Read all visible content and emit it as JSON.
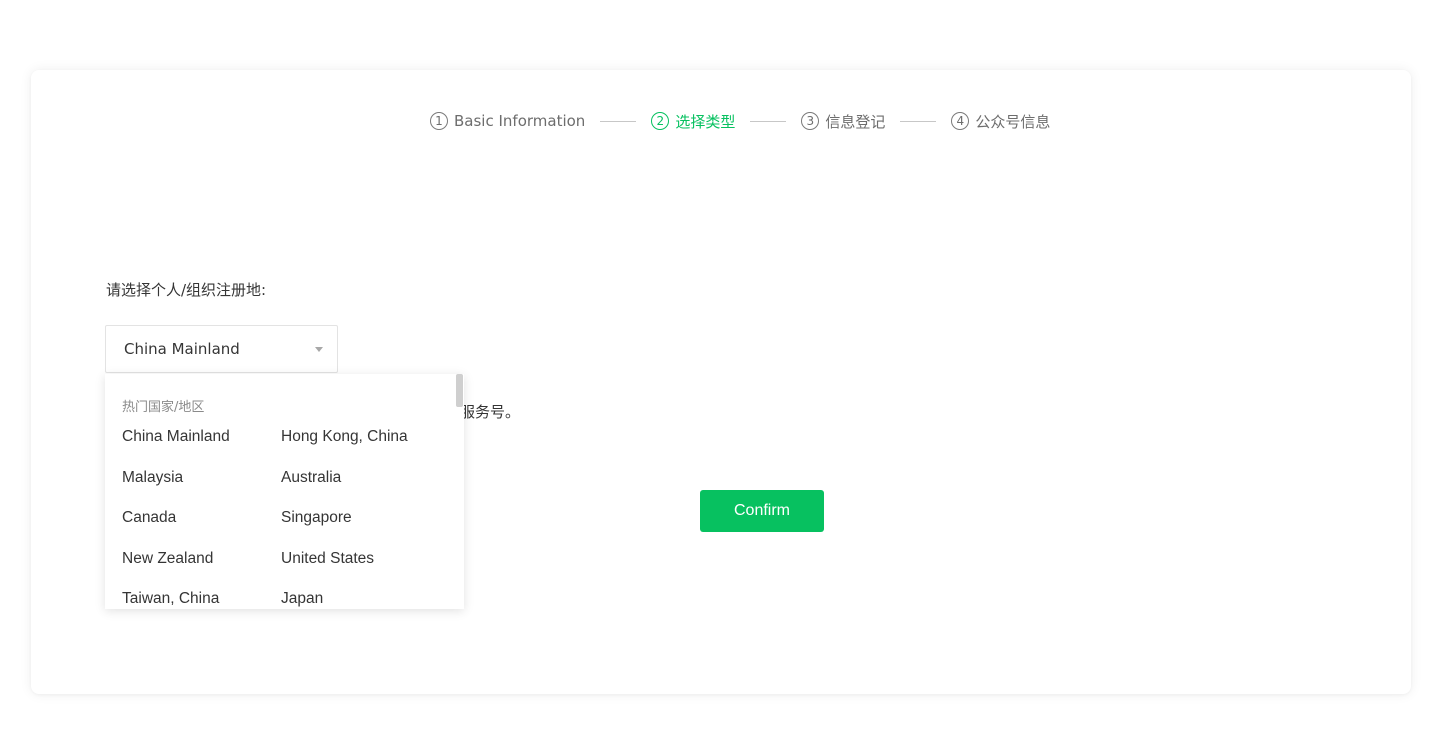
{
  "steps": [
    {
      "num": "1",
      "label": "Basic Information",
      "active": false
    },
    {
      "num": "2",
      "label": "选择类型",
      "active": true
    },
    {
      "num": "3",
      "label": "信息登记",
      "active": false
    },
    {
      "num": "4",
      "label": "公众号信息",
      "active": false
    }
  ],
  "region": {
    "label": "请选择个人/组织注册地:",
    "selected": "China Mainland"
  },
  "partially_hidden_text": "服务号。",
  "confirm_label": "Confirm",
  "dropdown": {
    "group_title": "热门国家/地区",
    "options": [
      "China Mainland",
      "Hong Kong, China",
      "Malaysia",
      "Australia",
      "Canada",
      "Singapore",
      "New Zealand",
      "United States",
      "Taiwan, China",
      "Japan"
    ]
  },
  "colors": {
    "accent": "#07c160",
    "text": "#353535",
    "muted": "#6d6d6d"
  }
}
